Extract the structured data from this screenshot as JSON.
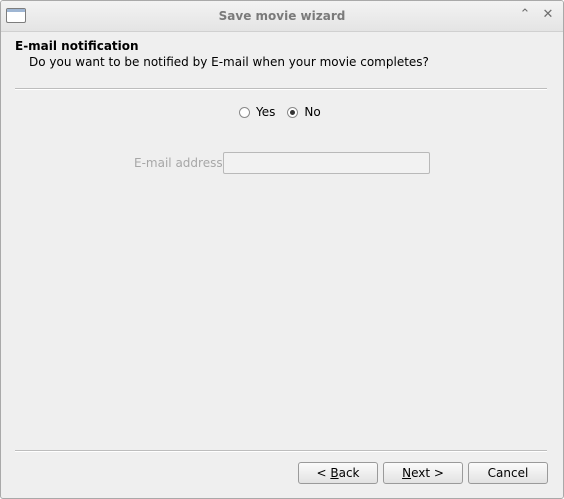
{
  "window": {
    "title": "Save movie wizard",
    "minimize_icon": "chevron-up-icon",
    "close_icon": "close-icon"
  },
  "page": {
    "heading": "E-mail notification",
    "subheading": "Do you want to be notified by E-mail when your movie completes?"
  },
  "notify_options": {
    "yes_label": "Yes",
    "no_label": "No",
    "selected": "No"
  },
  "email": {
    "label": "E-mail address",
    "value": ""
  },
  "buttons": {
    "back": {
      "prefix": "< ",
      "mnemonic": "B",
      "rest": "ack"
    },
    "next": {
      "mnemonic": "N",
      "rest": "ext >"
    },
    "cancel": "Cancel"
  }
}
